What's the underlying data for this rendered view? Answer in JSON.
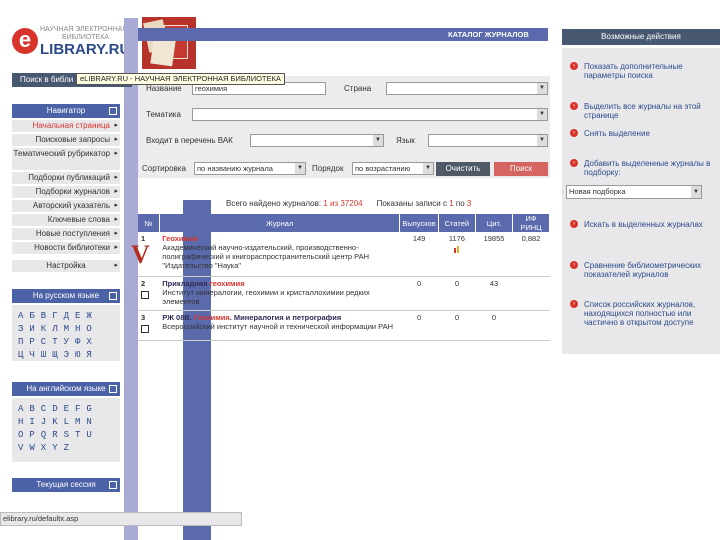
{
  "logo": {
    "sub_line1": "НАУЧНАЯ ЭЛЕКТРОННАЯ",
    "sub_line2": "БИБЛИОТЕКА",
    "main": "LIBRARY.RU",
    "e": "e"
  },
  "tooltip": "eLIBRARY.RU - НАУЧНАЯ ЭЛЕКТРОННАЯ БИБЛИОТЕКА",
  "search_bar": "Поиск в библи",
  "navigator": {
    "title": "Навигатор",
    "items": [
      {
        "label": "Начальная страница"
      },
      {
        "label": "Поисковые запросы"
      },
      {
        "label": "Тематический рубрикатор"
      },
      {
        "label": "Подборки публикаций"
      },
      {
        "label": "Подборки журналов"
      },
      {
        "label": "Авторский указатель"
      },
      {
        "label": "Ключевые слова"
      },
      {
        "label": "Новые поступления"
      },
      {
        "label": "Новости библиотеки"
      }
    ],
    "settings": "Настройка"
  },
  "russian": {
    "title": "На русском языке",
    "rows": [
      "АБВГДЕЖ",
      "ЗИКЛМНО",
      "ПРСТУФХ",
      "ЦЧШЩЭЮЯ"
    ]
  },
  "english": {
    "title": "На английском языке",
    "rows": [
      "ABCDEFG",
      "HIJKLMN",
      "OPQRSTU",
      "VWXYZ"
    ]
  },
  "current_session": "Текущая сессия",
  "center": {
    "header": "КАТАЛОГ ЖУРНАЛОВ",
    "name_label": "Название",
    "name_value": "геохимия",
    "country_label": "Страна",
    "topic_label": "Тематика",
    "vak_label": "Входит в перечень ВАК",
    "lang_label": "Язык",
    "sort_label": "Сортировка",
    "sort_value": "по названию журнала",
    "order_label": "Порядок",
    "order_value": "по возрастанию",
    "clear": "Очистить",
    "search": "Поиск",
    "found_prefix": "Всего найдено журналов:",
    "found_range": "1 из 37204",
    "found_suffix": "Показаны записи с",
    "found_from": "1",
    "found_to": "3",
    "found_to_word": "по"
  },
  "table": {
    "headers": [
      "№",
      "Журнал",
      "Выпусков",
      "Статей",
      "Цит.",
      "ИФ РИНЦ"
    ],
    "rows": [
      {
        "num": "1",
        "title": "Геохимия",
        "pre": "",
        "post": "",
        "desc": "Академический научно-издательский, производственно-полиграфический и книгораспространительский центр РАН \"Издательство \"Наука\"",
        "issues": "149",
        "articles": "1176",
        "cit": "19855",
        "if": "0,882"
      },
      {
        "num": "2",
        "title": "геохимия",
        "pre": "Прикладная ",
        "post": "",
        "desc": "Институт минералогии, геохимии и кристаллохимии редких элементов",
        "issues": "0",
        "articles": "0",
        "cit": "43",
        "if": ""
      },
      {
        "num": "3",
        "title": "Геохимия",
        "pre": "РЖ 08В. ",
        "post": ". Минералогия и петрография",
        "desc": "Всероссийский институт научной и технической информации РАН",
        "issues": "0",
        "articles": "0",
        "cit": "0",
        "if": ""
      }
    ]
  },
  "right": {
    "header": "Возможные действия",
    "actions": [
      "Показать дополнительные параметры поиска",
      "Выделить все журналы на этой странице",
      "Снять выделение",
      "Добавить выделенные журналы в подборку:",
      "Искать в выделенных журналах",
      "Сравнение библиометрических показателей журналов",
      "Список российских журналов, находящихся полностью или частично в открытом доступе"
    ],
    "select_value": "Новая подборка"
  },
  "status_url": "elibrary.ru/defaultx.asp"
}
